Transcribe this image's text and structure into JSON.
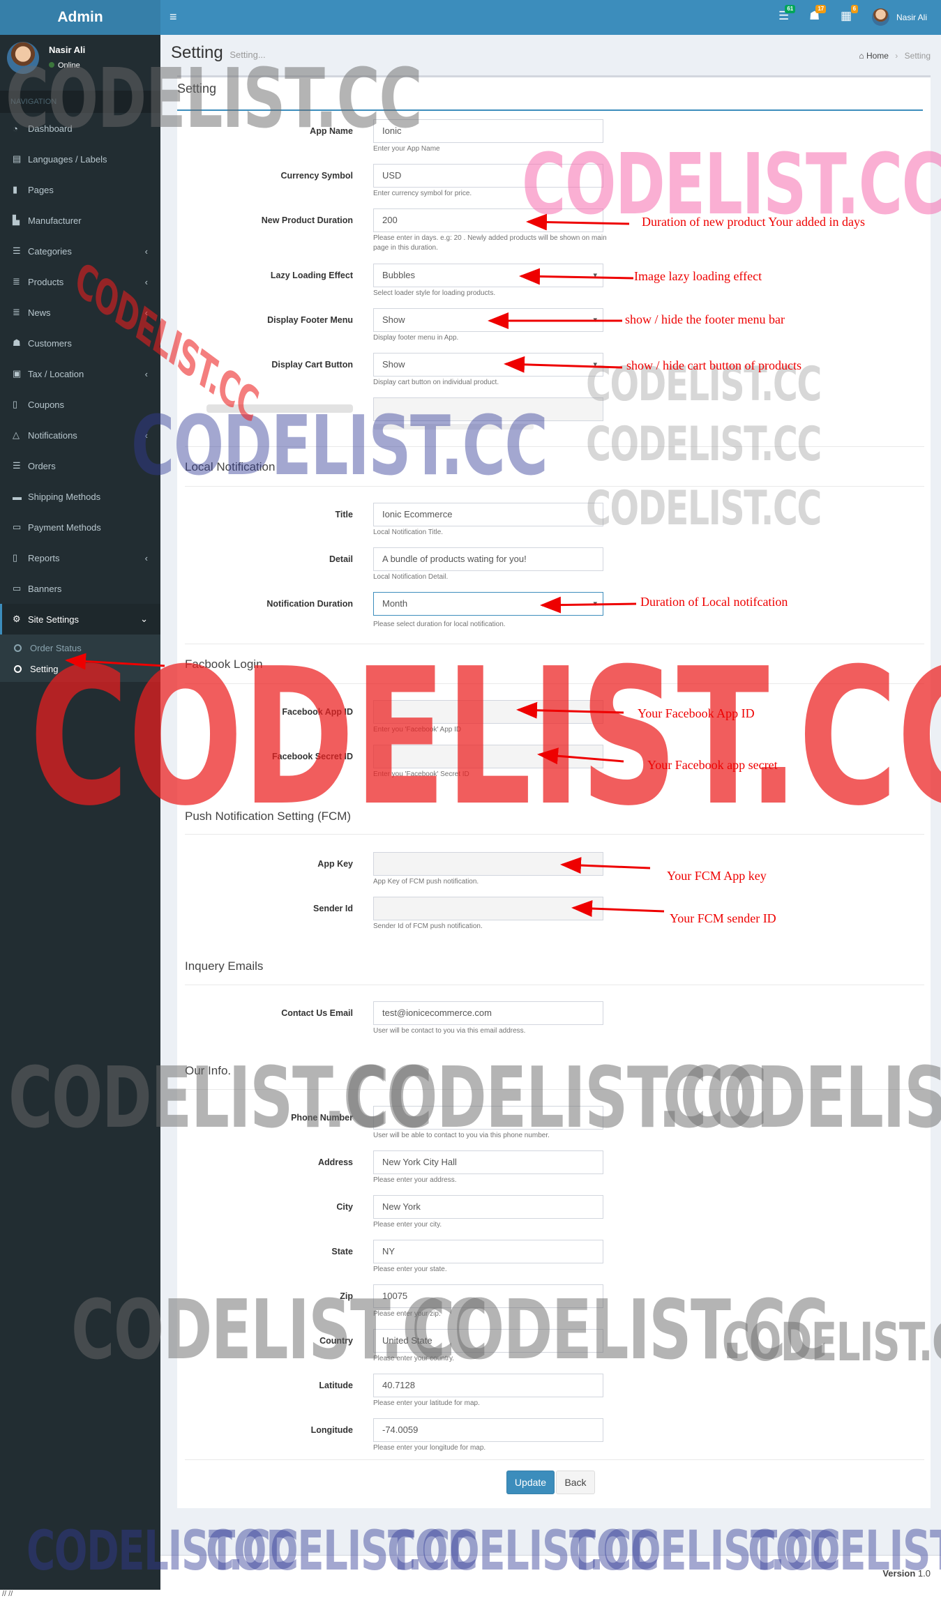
{
  "header": {
    "logo": "Admin",
    "hamburger_icon": "≡",
    "badges": [
      {
        "count": "61",
        "color": "#00a65a",
        "icon": "list-icon"
      },
      {
        "count": "17",
        "color": "#f39c12",
        "icon": "users-icon"
      },
      {
        "count": "6",
        "color": "#f39c12",
        "icon": "grid-icon"
      }
    ],
    "user_name": "Nasir Ali"
  },
  "sidebar": {
    "user_name": "Nasir Ali",
    "user_status": "Online",
    "nav_header": "NAVIGATION",
    "items": [
      {
        "label": "Dashboard",
        "icon": "dashboard-icon",
        "glyph": "◔",
        "chevron": ""
      },
      {
        "label": "Languages / Labels",
        "icon": "language-icon",
        "glyph": "▤",
        "chevron": ""
      },
      {
        "label": "Pages",
        "icon": "pages-icon",
        "glyph": "▮",
        "chevron": ""
      },
      {
        "label": "Manufacturer",
        "icon": "industry-icon",
        "glyph": "▙",
        "chevron": ""
      },
      {
        "label": "Categories",
        "icon": "bars-icon",
        "glyph": "☰",
        "chevron": "‹"
      },
      {
        "label": "Products",
        "icon": "database-icon",
        "glyph": "≣",
        "chevron": "‹"
      },
      {
        "label": "News",
        "icon": "database-icon",
        "glyph": "≣",
        "chevron": "‹"
      },
      {
        "label": "Customers",
        "icon": "users-icon",
        "glyph": "☗",
        "chevron": ""
      },
      {
        "label": "Tax / Location",
        "icon": "money-icon",
        "glyph": "▣",
        "chevron": "‹"
      },
      {
        "label": "Coupons",
        "icon": "tablet-icon",
        "glyph": "▯",
        "chevron": ""
      },
      {
        "label": "Notifications",
        "icon": "bell-icon",
        "glyph": "△",
        "chevron": "‹"
      },
      {
        "label": "Orders",
        "icon": "list-icon",
        "glyph": "☰",
        "chevron": ""
      },
      {
        "label": "Shipping Methods",
        "icon": "truck-icon",
        "glyph": "▬",
        "chevron": ""
      },
      {
        "label": "Payment Methods",
        "icon": "credit-card-icon",
        "glyph": "▭",
        "chevron": ""
      },
      {
        "label": "Reports",
        "icon": "file-icon",
        "glyph": "▯",
        "chevron": "‹"
      },
      {
        "label": "Banners",
        "icon": "banner-icon",
        "glyph": "▭",
        "chevron": ""
      },
      {
        "label": "Site Settings",
        "icon": "gears-icon",
        "glyph": "⚙",
        "chevron": "⌄"
      }
    ],
    "subitems": [
      {
        "label": "Order Status"
      },
      {
        "label": "Setting"
      }
    ]
  },
  "content_header": {
    "title": "Setting",
    "subtitle": "Setting...",
    "breadcrumb_home": "Home",
    "breadcrumb_current": "Setting"
  },
  "box_title": "Setting",
  "sections": {
    "local_notification": "Local Notification",
    "facebook_login": "Facbook Login",
    "push_notification": "Push Notification Setting (FCM)",
    "inquiry_emails": "Inquery Emails",
    "our_info": "Our Info."
  },
  "fields": {
    "app_name": {
      "label": "App Name",
      "value": "Ionic",
      "help": "Enter your App Name"
    },
    "currency_symbol": {
      "label": "Currency Symbol",
      "value": "USD",
      "help": "Enter currency symbol for price."
    },
    "new_product_duration": {
      "label": "New Product Duration",
      "value": "200",
      "help": "Please enter in days. e.g: 20 . Newly added products will be shown on main page in this duration."
    },
    "lazy_loading": {
      "label": "Lazy Loading Effect",
      "value": "Bubbles",
      "help": "Select loader style for loading products."
    },
    "display_footer_menu": {
      "label": "Display Footer Menu",
      "value": "Show",
      "help": "Display footer menu in App."
    },
    "display_cart_button": {
      "label": "Display Cart Button",
      "value": "Show",
      "help": "Display cart button on individual product."
    },
    "notif_title": {
      "label": "Title",
      "value": "Ionic Ecommerce",
      "help": "Local Notification Title."
    },
    "notif_detail": {
      "label": "Detail",
      "value": "A bundle of products wating for you!",
      "help": "Local Notification Detail."
    },
    "notif_duration": {
      "label": "Notification Duration",
      "value": "Month",
      "help": "Please select duration for local notification."
    },
    "fb_app_id": {
      "label": "Facebook App ID",
      "help": "Enter you 'Facebook' App ID"
    },
    "fb_secret": {
      "label": "Facebook Secret ID",
      "help": "Enter you 'Facebook' Secret ID"
    },
    "fcm_app_key": {
      "label": "App Key",
      "help": "App Key of FCM push notification."
    },
    "fcm_sender_id": {
      "label": "Sender Id",
      "help": "Sender Id of FCM push notification."
    },
    "contact_email": {
      "label": "Contact Us Email",
      "value": "test@ionicecommerce.com",
      "help": "User will be contact to you via this email address."
    },
    "phone": {
      "label": "Phone Number",
      "help": "User will be able to contact to you via this phone number."
    },
    "address": {
      "label": "Address",
      "value": "New York City Hall",
      "help": "Please enter your address."
    },
    "city": {
      "label": "City",
      "value": "New York",
      "help": "Please enter your city."
    },
    "state": {
      "label": "State",
      "value": "NY",
      "help": "Please enter your state."
    },
    "zip": {
      "label": "Zip",
      "value": "10075",
      "help": "Please enter your zip."
    },
    "country": {
      "label": "Country",
      "value": "United State",
      "help": "Please enter your country."
    },
    "latitude": {
      "label": "Latitude",
      "value": "40.7128",
      "help": "Please enter your latitude for map."
    },
    "longitude": {
      "label": "Longitude",
      "value": "-74.0059",
      "help": "Please enter your longitude for map."
    }
  },
  "buttons": {
    "update": "Update",
    "back": "Back"
  },
  "footer": {
    "version_label": "Version",
    "version_number": "1.0"
  },
  "bottom_text": "// //",
  "annotations": {
    "duration": "Duration of new product Your added in days",
    "lazy": "Image lazy loading effect",
    "footer_menu": "show / hide the footer menu bar",
    "cart_button": "show / hide cart button of products",
    "local_duration": "Duration of Local notifcation",
    "fb_app_id": "Your Facebook App ID",
    "fb_secret": "Your Facebook app secret",
    "fcm_key": "Your FCM App key",
    "fcm_sender": "Your FCM sender ID"
  },
  "watermark": "CODELIST.CC",
  "colors": {
    "header": "#3c8dbc",
    "sidebar": "#222d32",
    "annotation": "#ee0000"
  }
}
